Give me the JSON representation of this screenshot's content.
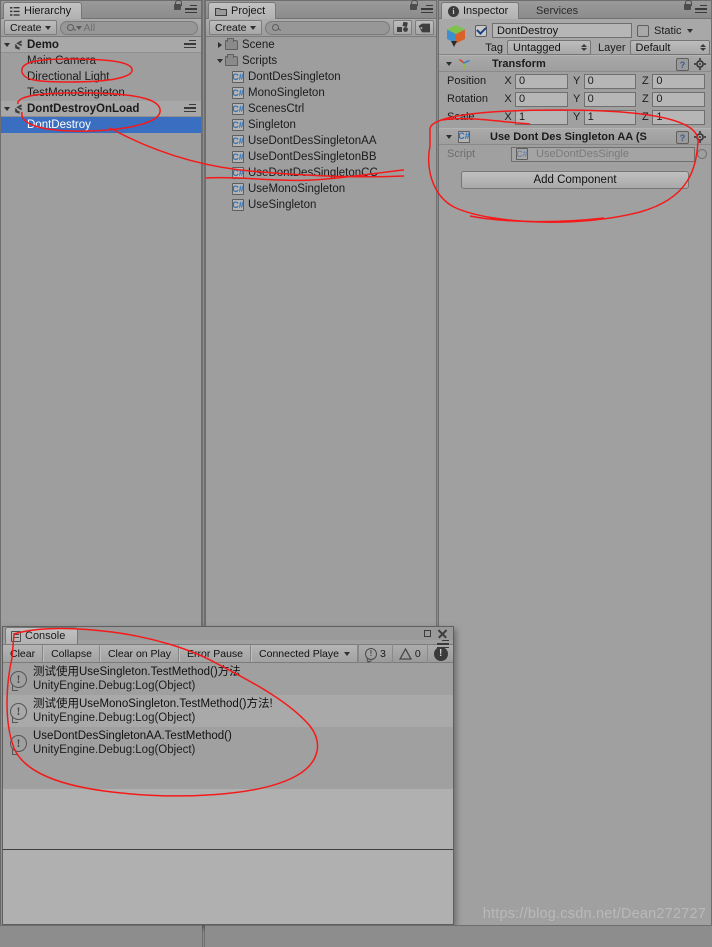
{
  "hierarchy": {
    "tab_label": "Hierarchy",
    "create_label": "Create",
    "search_placeholder": "All",
    "items": [
      {
        "label": "Demo",
        "type": "scene",
        "indent": 0,
        "expanded": true,
        "selected": false
      },
      {
        "label": "Main Camera",
        "type": "object",
        "indent": 1,
        "expanded": null,
        "selected": false
      },
      {
        "label": "Directional Light",
        "type": "object",
        "indent": 1,
        "expanded": null,
        "selected": false
      },
      {
        "label": "TestMonoSingleton",
        "type": "object",
        "indent": 1,
        "expanded": null,
        "selected": false
      },
      {
        "label": "DontDestroyOnLoad",
        "type": "scene",
        "indent": 0,
        "expanded": true,
        "selected": false
      },
      {
        "label": "DontDestroy",
        "type": "object",
        "indent": 1,
        "expanded": null,
        "selected": true
      }
    ]
  },
  "project": {
    "tab_label": "Project",
    "create_label": "Create",
    "search_placeholder": "",
    "items": [
      {
        "label": "Scene",
        "type": "folder",
        "indent": 0,
        "expanded": false
      },
      {
        "label": "Scripts",
        "type": "folder",
        "indent": 0,
        "expanded": true
      },
      {
        "label": "DontDesSingleton",
        "type": "script",
        "indent": 1,
        "expanded": null
      },
      {
        "label": "MonoSingleton",
        "type": "script",
        "indent": 1,
        "expanded": null
      },
      {
        "label": "ScenesCtrl",
        "type": "script",
        "indent": 1,
        "expanded": null
      },
      {
        "label": "Singleton",
        "type": "script",
        "indent": 1,
        "expanded": null
      },
      {
        "label": "UseDontDesSingletonAA",
        "type": "script",
        "indent": 1,
        "expanded": null
      },
      {
        "label": "UseDontDesSingletonBB",
        "type": "script",
        "indent": 1,
        "expanded": null
      },
      {
        "label": "UseDontDesSingletonCC",
        "type": "script",
        "indent": 1,
        "expanded": null
      },
      {
        "label": "UseMonoSingleton",
        "type": "script",
        "indent": 1,
        "expanded": null
      },
      {
        "label": "UseSingleton",
        "type": "script",
        "indent": 1,
        "expanded": null
      }
    ],
    "script_icon_glyph": "C#"
  },
  "inspector": {
    "tab_label": "Inspector",
    "services_tab_label": "Services",
    "object_name": "DontDestroy",
    "object_enabled": true,
    "static_label": "Static",
    "static_checked": false,
    "tag_label": "Tag",
    "tag_value": "Untagged",
    "layer_label": "Layer",
    "layer_value": "Default",
    "transform": {
      "title": "Transform",
      "rows": [
        {
          "label": "Position",
          "x": "0",
          "y": "0",
          "z": "0"
        },
        {
          "label": "Rotation",
          "x": "0",
          "y": "0",
          "z": "0"
        },
        {
          "label": "Scale",
          "x": "1",
          "y": "1",
          "z": "1"
        }
      ],
      "axis_labels": [
        "X",
        "Y",
        "Z"
      ]
    },
    "component": {
      "title": "Use Dont Des Singleton AA (S",
      "script_label": "Script",
      "script_value": "UseDontDesSingle"
    },
    "add_component_label": "Add Component"
  },
  "console": {
    "tab_label": "Console",
    "buttons": [
      {
        "label": "Clear",
        "dropdown": false
      },
      {
        "label": "Collapse",
        "dropdown": false
      },
      {
        "label": "Clear on Play",
        "dropdown": false
      },
      {
        "label": "Error Pause",
        "dropdown": false
      },
      {
        "label": "Connected Playe",
        "dropdown": true
      }
    ],
    "counts": {
      "log": "3",
      "warning": "0",
      "error": ""
    },
    "logs": [
      {
        "message": "测试使用UseSingleton.TestMethod()方法",
        "stack": "UnityEngine.Debug:Log(Object)",
        "alt": false
      },
      {
        "message": "测试使用UseMonoSingleton.TestMethod()方法!",
        "stack": "UnityEngine.Debug:Log(Object)",
        "alt": true
      },
      {
        "message": "UseDontDesSingletonAA.TestMethod()",
        "stack": "UnityEngine.Debug:Log(Object)",
        "alt": false
      }
    ]
  },
  "watermark": "https://blog.csdn.net/Dean272727",
  "colors": {
    "selection_blue": "#3a6ec0",
    "panel_bg": "#9e9e9e",
    "toolbar_bg": "#a8a8a8",
    "annotation_red": "#f51a1a",
    "script_icon_blue": "#2f6fb5"
  }
}
